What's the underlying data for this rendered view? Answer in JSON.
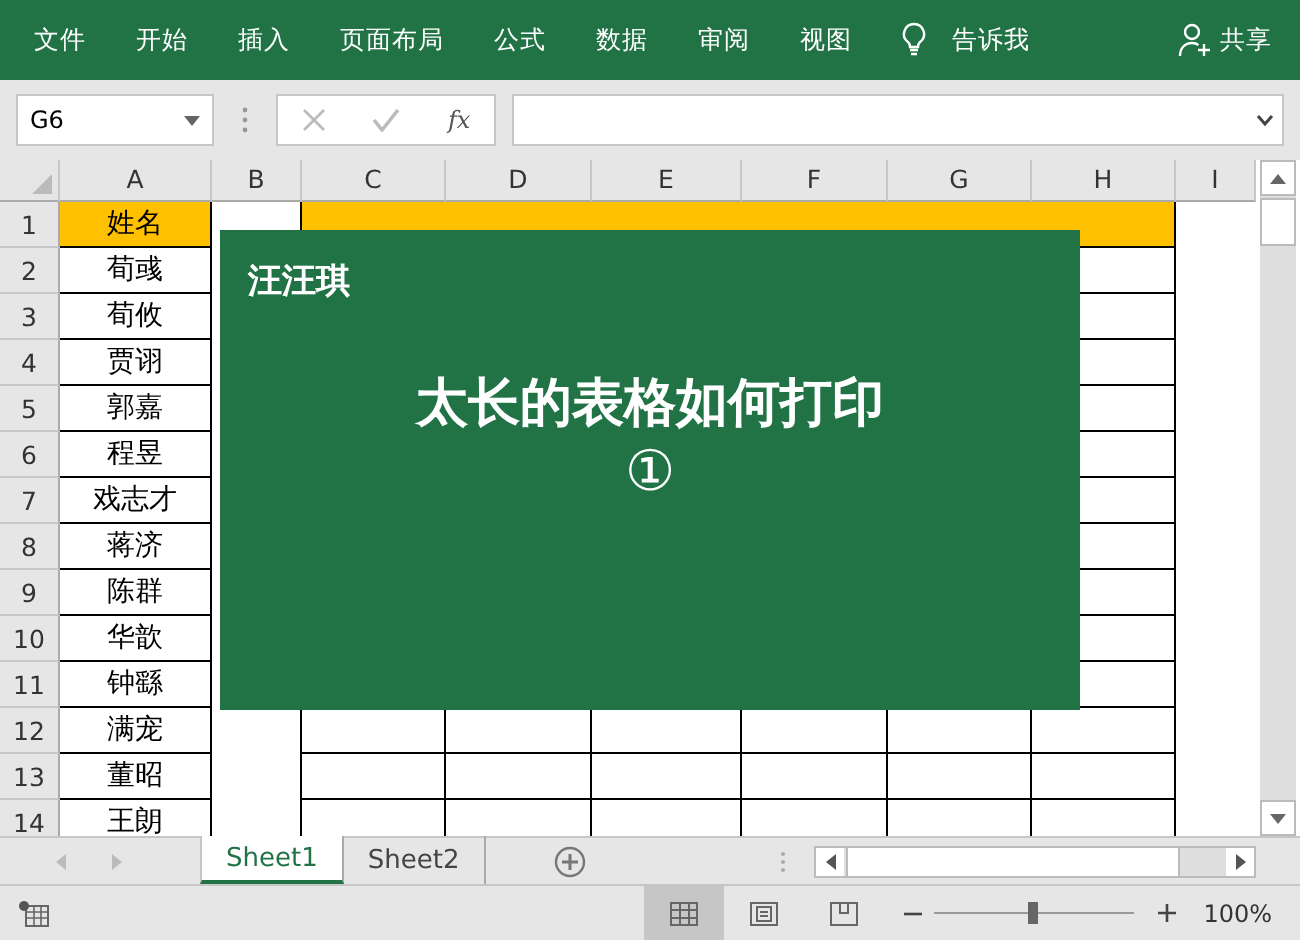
{
  "ribbon": {
    "tabs": [
      "文件",
      "开始",
      "插入",
      "页面布局",
      "公式",
      "数据",
      "审阅",
      "视图"
    ],
    "tell_me": "告诉我",
    "share": "共享"
  },
  "formula_bar": {
    "name_box": "G6",
    "function_label": "fx"
  },
  "columns": [
    "A",
    "B",
    "C",
    "D",
    "E",
    "F",
    "G",
    "H",
    "I"
  ],
  "rows": [
    {
      "number": "1",
      "name": "姓名",
      "kind": "header"
    },
    {
      "number": "2",
      "name": "荀彧"
    },
    {
      "number": "3",
      "name": "荀攸"
    },
    {
      "number": "4",
      "name": "贾诩"
    },
    {
      "number": "5",
      "name": "郭嘉"
    },
    {
      "number": "6",
      "name": "程昱"
    },
    {
      "number": "7",
      "name": "戏志才"
    },
    {
      "number": "8",
      "name": "蒋济"
    },
    {
      "number": "9",
      "name": "陈群"
    },
    {
      "number": "10",
      "name": "华歆"
    },
    {
      "number": "11",
      "name": "钟繇"
    },
    {
      "number": "12",
      "name": "满宠"
    },
    {
      "number": "13",
      "name": "董昭"
    },
    {
      "number": "14",
      "name": "王朗"
    }
  ],
  "overlay": {
    "author": "汪汪琪",
    "title": "太长的表格如何打印",
    "number": "①"
  },
  "sheets": [
    {
      "label": "Sheet1",
      "selected": true
    },
    {
      "label": "Sheet2",
      "selected": false
    }
  ],
  "status_bar": {
    "views": [
      {
        "kind": "normal",
        "selected": true
      },
      {
        "kind": "page_layout",
        "selected": false
      },
      {
        "kind": "page_break",
        "selected": false
      }
    ],
    "zoom": {
      "level": 0.5,
      "reading": "100%"
    }
  }
}
